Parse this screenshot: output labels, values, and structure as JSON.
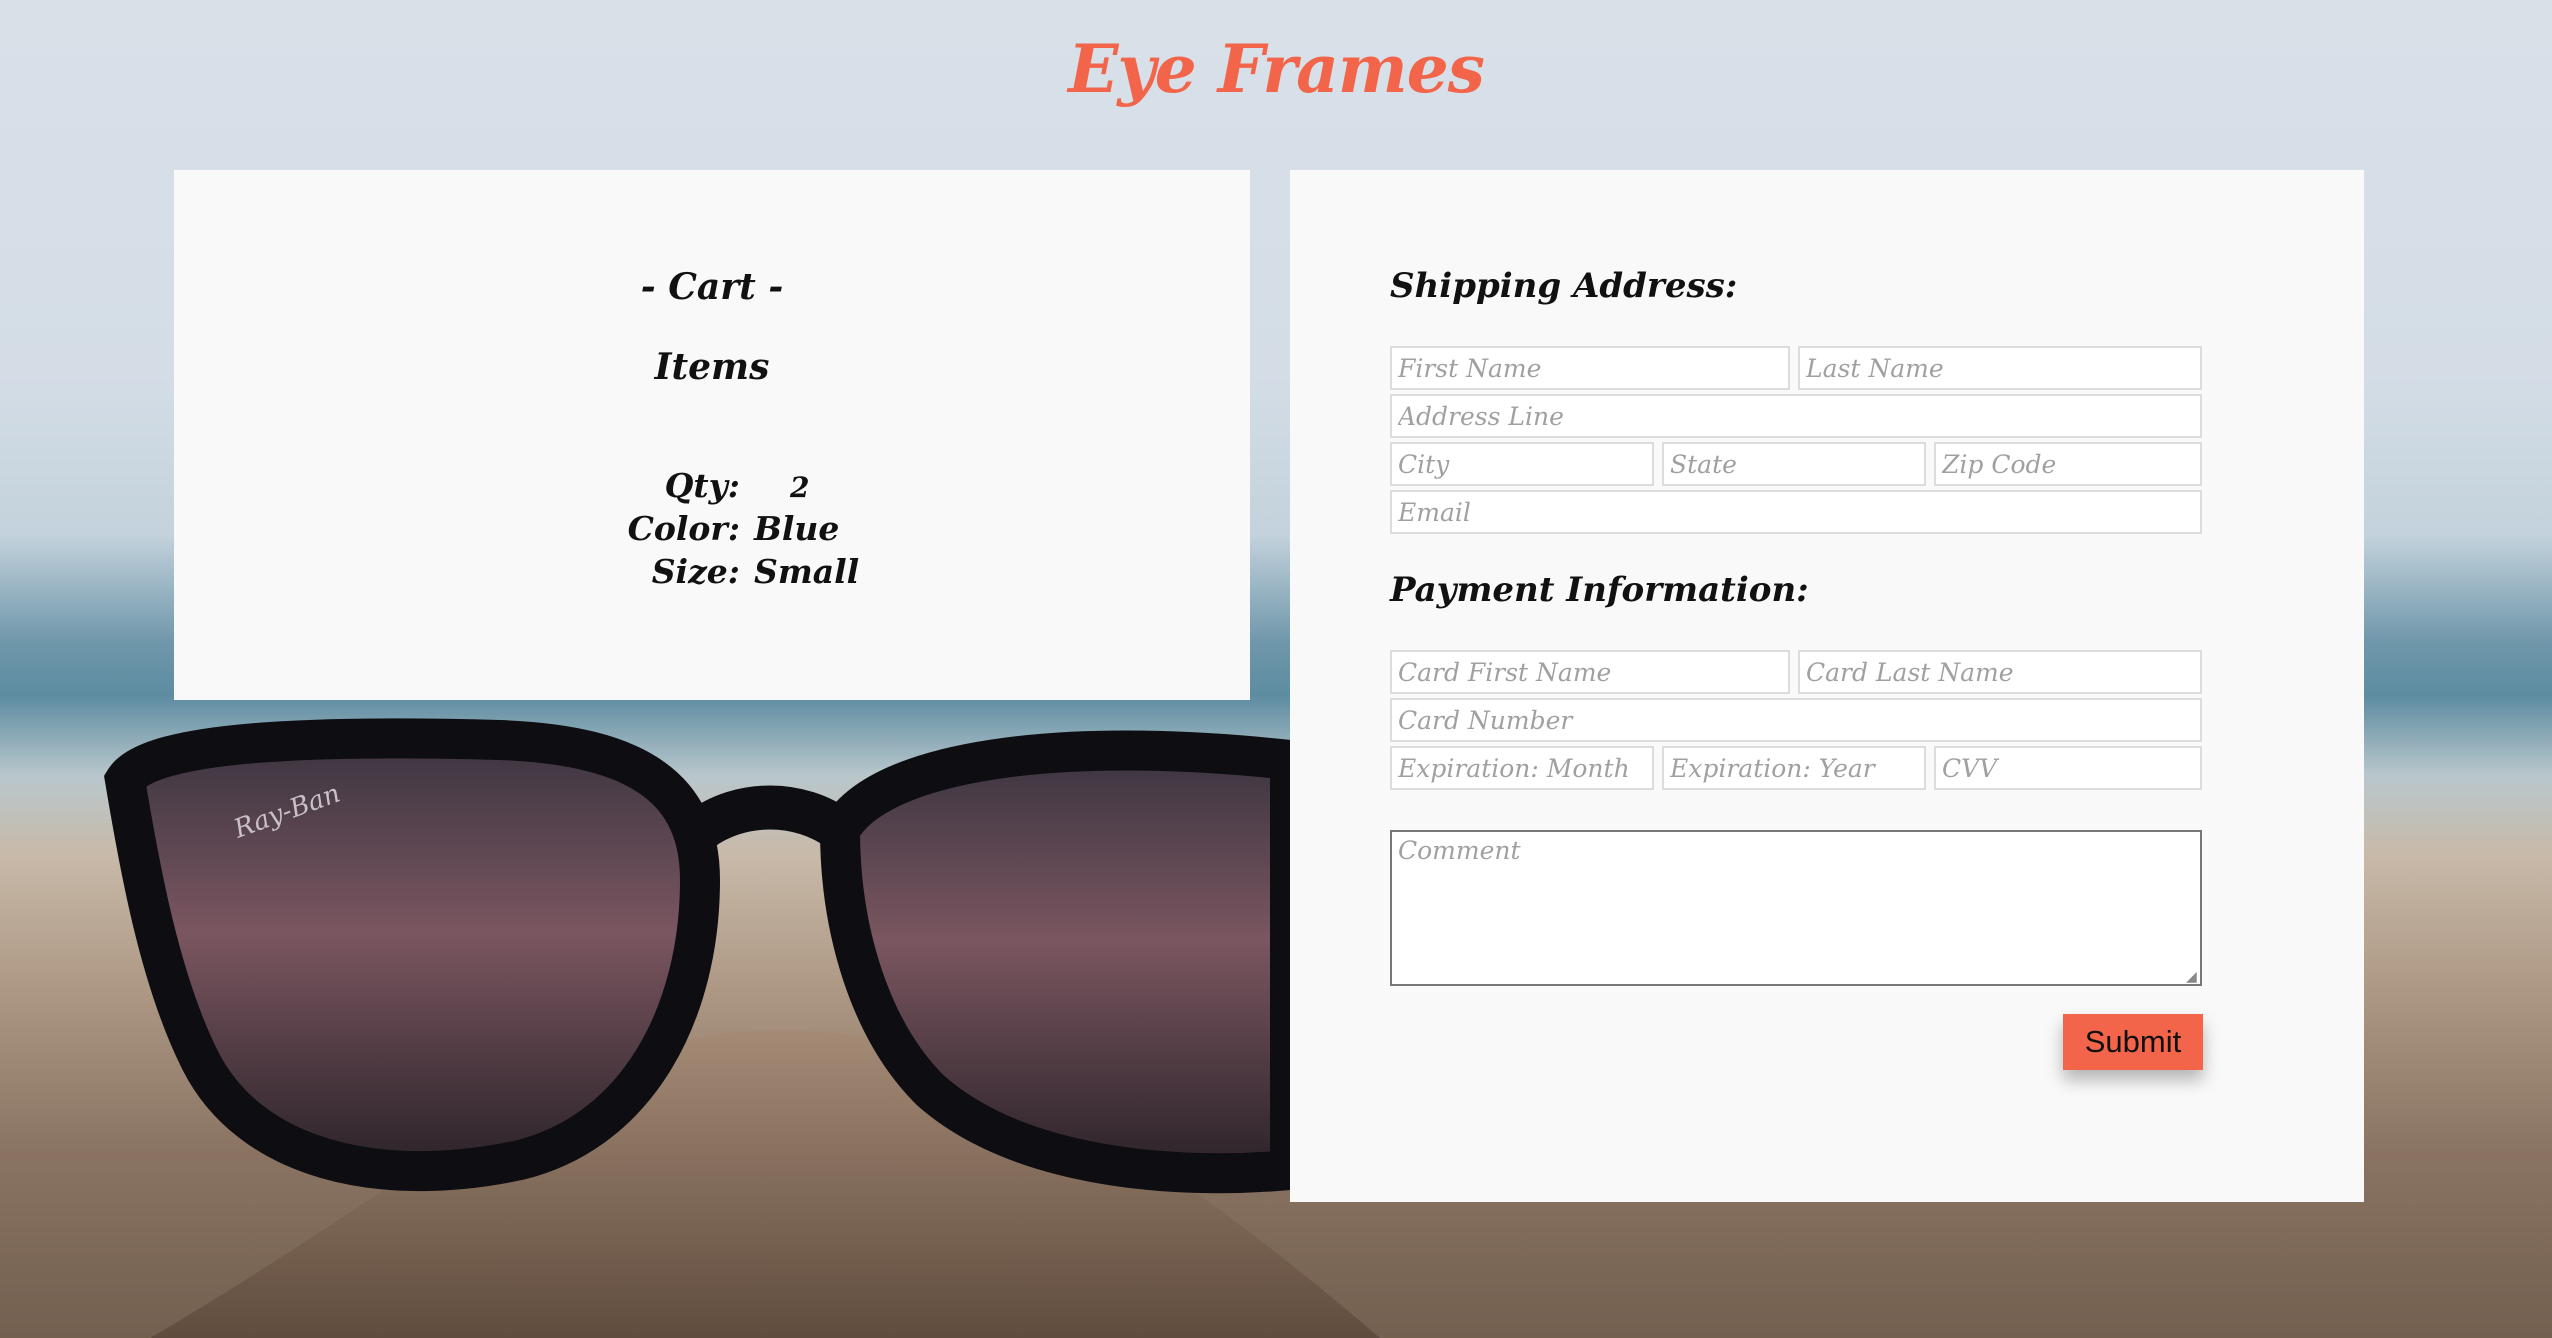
{
  "header": {
    "title": "Eye Frames"
  },
  "cart": {
    "heading": "- Cart -",
    "subheading": "Items",
    "qty_label": "Qty:",
    "qty_value": "2",
    "color_label": "Color:",
    "color_value": "Blue",
    "size_label": "Size:",
    "size_value": "Small"
  },
  "shipping": {
    "heading": "Shipping Address:",
    "first_name_placeholder": "First Name",
    "last_name_placeholder": "Last Name",
    "address_placeholder": "Address Line",
    "city_placeholder": "City",
    "state_placeholder": "State",
    "zip_placeholder": "Zip Code",
    "email_placeholder": "Email"
  },
  "payment": {
    "heading": "Payment Information:",
    "card_first_name_placeholder": "Card First Name",
    "card_last_name_placeholder": "Card Last Name",
    "card_number_placeholder": "Card Number",
    "exp_month_placeholder": "Expiration: Month",
    "exp_year_placeholder": "Expiration: Year",
    "cvv_placeholder": "CVV"
  },
  "comment": {
    "placeholder": "Comment"
  },
  "submit_label": "Submit",
  "colors": {
    "accent": "#f2654a",
    "panel": "#f9f9f9"
  },
  "background_image": {
    "brand_mark": "Ray-Ban"
  }
}
